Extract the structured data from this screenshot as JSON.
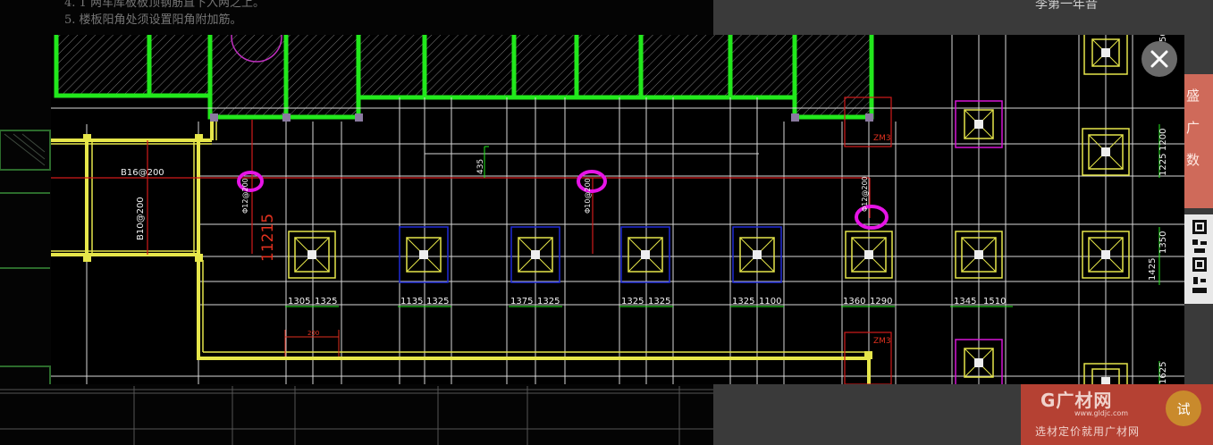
{
  "background": {
    "note_line_4": "4. 1 两车库板板顶钢筋直下入两之上。",
    "note_line_5": "5. 楼板阳角处须设置阳角附加筋。",
    "right_caption": "李第一年音"
  },
  "ad": {
    "logo": "G广材网",
    "url": "www.gldjc.com",
    "slogan": "选材定价就用广材网",
    "try_label": "试"
  },
  "side_widget": {
    "text": "盛广数"
  },
  "viewer": {
    "close_icon": "close-icon"
  },
  "drawing": {
    "left_label_1": "B16@200",
    "left_label_2": "B10@200",
    "rebar_label_1": "Φ12@200",
    "rebar_label_2": "Φ10@200",
    "rebar_label_3": "Φ12@200",
    "dim_vertical": "11215",
    "dim_small": "435",
    "dim_bottom_short": "200",
    "zm_top": "ZM3",
    "zm_bottom": "ZM3",
    "pile_dims": [
      [
        "1305",
        "1325"
      ],
      [
        "1135",
        "1325"
      ],
      [
        "1375",
        "1325"
      ],
      [
        "1325",
        "1325"
      ],
      [
        "1325",
        "1100"
      ],
      [
        "1360",
        "1290"
      ],
      [
        "1345",
        "1510"
      ]
    ],
    "right_dims": {
      "top_a": "1225",
      "top_b": "1200",
      "mid_a": "1425",
      "mid_b": "1350",
      "bottom": "1625",
      "top_cut": "50"
    },
    "colors": {
      "wall_green": "#22e81c",
      "grid_white": "#d7d7d7",
      "axis_red": "#d11a1a",
      "dim_red": "#e0311f",
      "pile_yellow": "#e6e64a",
      "pile_blue": "#1f2bd6",
      "pile_magenta": "#d616d6",
      "highlight": "#e614e6"
    }
  }
}
